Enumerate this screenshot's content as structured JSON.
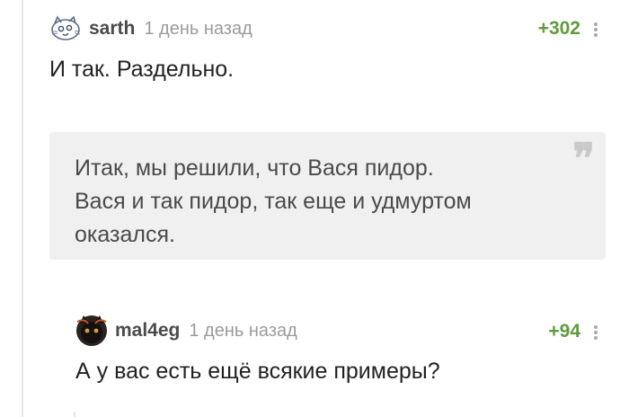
{
  "comments": [
    {
      "username": "sarth",
      "time": "1 день назад",
      "rating": "+302",
      "text": "И так. Раздельно.",
      "avatar_icon": "cat-sketch-avatar",
      "quote": {
        "lines": [
          "Итак, мы решили, что Вася пидор.",
          "Вася и так пидор, так еще и удмуртом",
          "оказался."
        ],
        "icon": "quote-mark-icon"
      }
    },
    {
      "username": "mal4eg",
      "time": "1 день назад",
      "rating": "+94",
      "text": "А у вас есть ещё всякие примеры?",
      "avatar_icon": "black-cat-avatar"
    }
  ],
  "colors": {
    "rating": "#5e9c3a",
    "quote_background": "#f0f0f0",
    "muted_text": "#9b9b9b"
  }
}
